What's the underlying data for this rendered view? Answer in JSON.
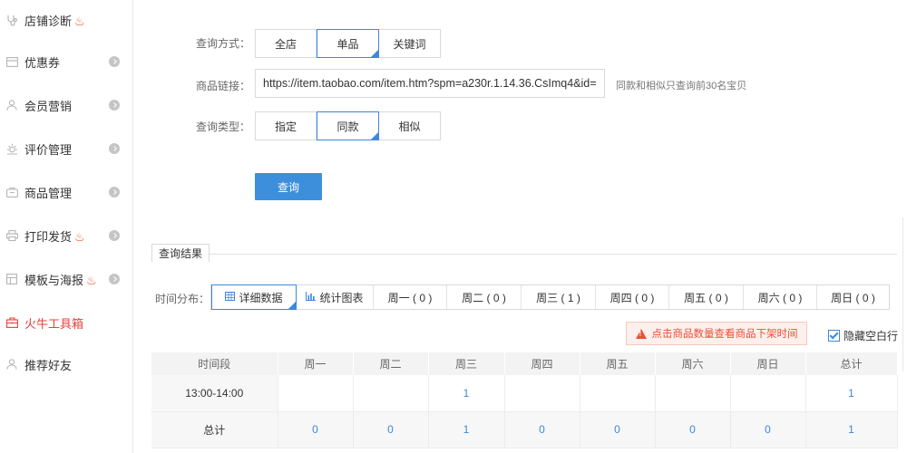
{
  "sidebar": {
    "items": [
      {
        "label": "店铺诊断",
        "icon": "stethoscope-icon",
        "flame": true,
        "arrow": false,
        "active": false
      },
      {
        "label": "优惠券",
        "icon": "coupon-icon",
        "flame": false,
        "arrow": true,
        "active": false
      },
      {
        "label": "会员营销",
        "icon": "user-icon",
        "flame": false,
        "arrow": true,
        "active": false
      },
      {
        "label": "评价管理",
        "icon": "sun-icon",
        "flame": false,
        "arrow": true,
        "active": false
      },
      {
        "label": "商品管理",
        "icon": "bag-icon",
        "flame": false,
        "arrow": true,
        "active": false
      },
      {
        "label": "打印发货",
        "icon": "printer-icon",
        "flame": true,
        "arrow": true,
        "active": false
      },
      {
        "label": "模板与海报",
        "icon": "template-icon",
        "flame": true,
        "arrow": true,
        "active": false
      },
      {
        "label": "火牛工具箱",
        "icon": "toolbox-icon",
        "flame": false,
        "arrow": false,
        "active": true
      },
      {
        "label": "推荐好友",
        "icon": "user-icon",
        "flame": false,
        "arrow": false,
        "active": false
      }
    ],
    "active_color": "#e8403a"
  },
  "form": {
    "query_mode": {
      "label": "查询方式：",
      "options": [
        "全店",
        "单品",
        "关键词"
      ],
      "selected": "单品"
    },
    "product_link": {
      "label": "商品链接：",
      "value": "https://item.taobao.com/item.htm?spm=a230r.1.14.36.CsImq4&id=",
      "hint": "同款和相似只查询前30名宝贝"
    },
    "query_type": {
      "label": "查询类型：",
      "options": [
        "指定",
        "同款",
        "相似"
      ],
      "selected": "同款"
    },
    "query_button": "查询"
  },
  "results": {
    "legend": "查询结果",
    "time_label": "时间分布：",
    "tabs": [
      {
        "label": "详细数据",
        "icon": "table-icon",
        "selected": true
      },
      {
        "label": "统计图表",
        "icon": "bar-chart-icon",
        "selected": false
      },
      {
        "label": "周一 ( 0 )",
        "selected": false
      },
      {
        "label": "周二 ( 0 )",
        "selected": false
      },
      {
        "label": "周三 ( 1 )",
        "selected": false
      },
      {
        "label": "周四 ( 0 )",
        "selected": false
      },
      {
        "label": "周五 ( 0 )",
        "selected": false
      },
      {
        "label": "周六 ( 0 )",
        "selected": false
      },
      {
        "label": "周日 ( 0 )",
        "selected": false
      }
    ],
    "notice": "点击商品数量查看商品下架时间",
    "hide_blank_label": "隐藏空白行",
    "hide_blank_checked": true,
    "table": {
      "headers": [
        "时间段",
        "周一",
        "周二",
        "周三",
        "周四",
        "周五",
        "周六",
        "周日",
        "总计"
      ],
      "rows": [
        [
          "13:00-14:00",
          "",
          "",
          "1",
          "",
          "",
          "",
          "",
          "1"
        ],
        [
          "总计",
          "0",
          "0",
          "1",
          "0",
          "0",
          "0",
          "0",
          "1"
        ]
      ]
    },
    "accent_color": "#3d87de"
  }
}
